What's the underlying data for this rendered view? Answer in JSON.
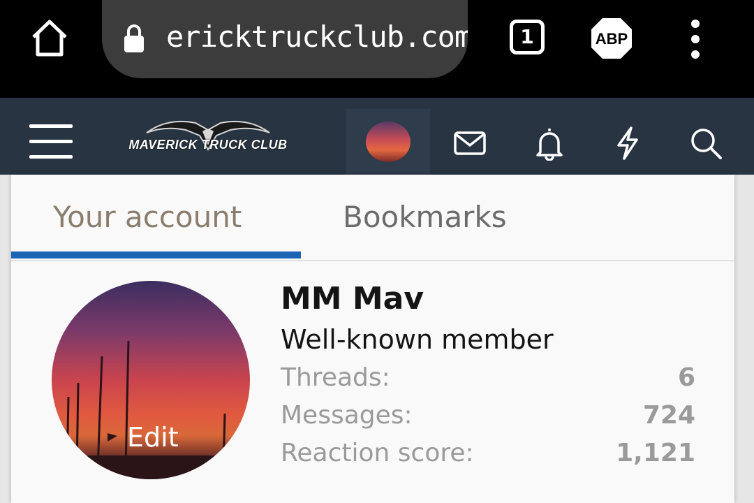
{
  "browser": {
    "url": "ericktruckclub.com",
    "tab_count": "1",
    "adblock_label": "ABP"
  },
  "site": {
    "logo_text": "MAVERICK TRUCK CLUB"
  },
  "account_menu": {
    "tabs": [
      {
        "label": "Your account"
      },
      {
        "label": "Bookmarks"
      }
    ],
    "avatar_edit_label": "Edit",
    "username": "MM Mav",
    "user_title": "Well-known member",
    "stats": [
      {
        "label": "Threads:",
        "value": "6"
      },
      {
        "label": "Messages:",
        "value": "724"
      },
      {
        "label": "Reaction score:",
        "value": "1,121"
      }
    ]
  },
  "colors": {
    "browser_bar": "#000000",
    "site_header": "#283442",
    "active_tab_underline": "#1b65b4"
  }
}
